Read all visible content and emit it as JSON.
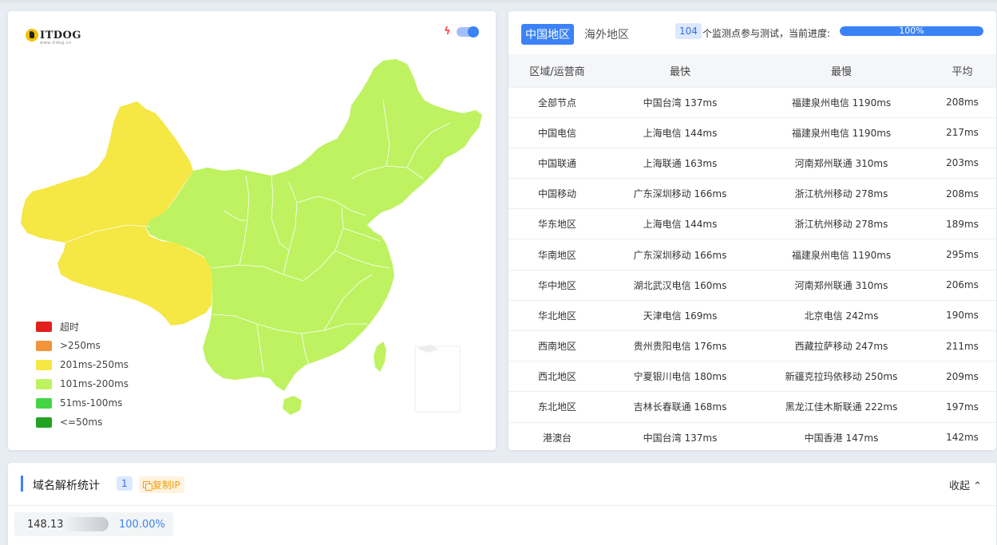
{
  "logo": {
    "text": "ITDOG",
    "sub": "www.itdog.cn"
  },
  "map": {
    "legend": [
      {
        "label": "超时",
        "color": "#e0201c"
      },
      {
        "label": ">250ms",
        "color": "#f0953a"
      },
      {
        "label": "201ms-250ms",
        "color": "#f5e744"
      },
      {
        "label": "101ms-200ms",
        "color": "#bef261"
      },
      {
        "label": "51ms-100ms",
        "color": "#44d444"
      },
      {
        "label": "<=50ms",
        "color": "#22a322"
      }
    ],
    "colors": {
      "west": "#f5e744",
      "east": "#bef261",
      "taiwan": "#bef261",
      "hainan": "#bef261"
    }
  },
  "tabs": {
    "active": "中国地区",
    "other": "海外地区"
  },
  "progress": {
    "count": "104",
    "label": "个监测点参与测试，当前进度:",
    "value": "100%",
    "fraction": 1.0
  },
  "table": {
    "headers": [
      "区域/运营商",
      "最快",
      "最慢",
      "平均"
    ],
    "rows": [
      [
        "全部节点",
        "中国台湾 137ms",
        "福建泉州电信 1190ms",
        "208ms"
      ],
      [
        "中国电信",
        "上海电信 144ms",
        "福建泉州电信 1190ms",
        "217ms"
      ],
      [
        "中国联通",
        "上海联通 163ms",
        "河南郑州联通 310ms",
        "203ms"
      ],
      [
        "中国移动",
        "广东深圳移动 166ms",
        "浙江杭州移动 278ms",
        "208ms"
      ],
      [
        "华东地区",
        "上海电信 144ms",
        "浙江杭州移动 278ms",
        "189ms"
      ],
      [
        "华南地区",
        "广东深圳移动 166ms",
        "福建泉州电信 1190ms",
        "295ms"
      ],
      [
        "华中地区",
        "湖北武汉电信 160ms",
        "河南郑州联通 310ms",
        "206ms"
      ],
      [
        "华北地区",
        "天津电信 169ms",
        "北京电信 242ms",
        "190ms"
      ],
      [
        "西南地区",
        "贵州贵阳电信 176ms",
        "西藏拉萨移动 247ms",
        "211ms"
      ],
      [
        "西北地区",
        "宁夏银川电信 180ms",
        "新疆克拉玛依移动 250ms",
        "209ms"
      ],
      [
        "东北地区",
        "吉林长春联通 168ms",
        "黑龙江佳木斯联通 222ms",
        "197ms"
      ],
      [
        "港澳台",
        "中国台湾 137ms",
        "中国香港 147ms",
        "142ms"
      ]
    ]
  },
  "dns": {
    "title": "域名解析统计",
    "count": "1",
    "copy_label": "复制IP",
    "collapse_label": "收起",
    "ip_visible": "148.13",
    "ip_pct": "100.00%"
  }
}
